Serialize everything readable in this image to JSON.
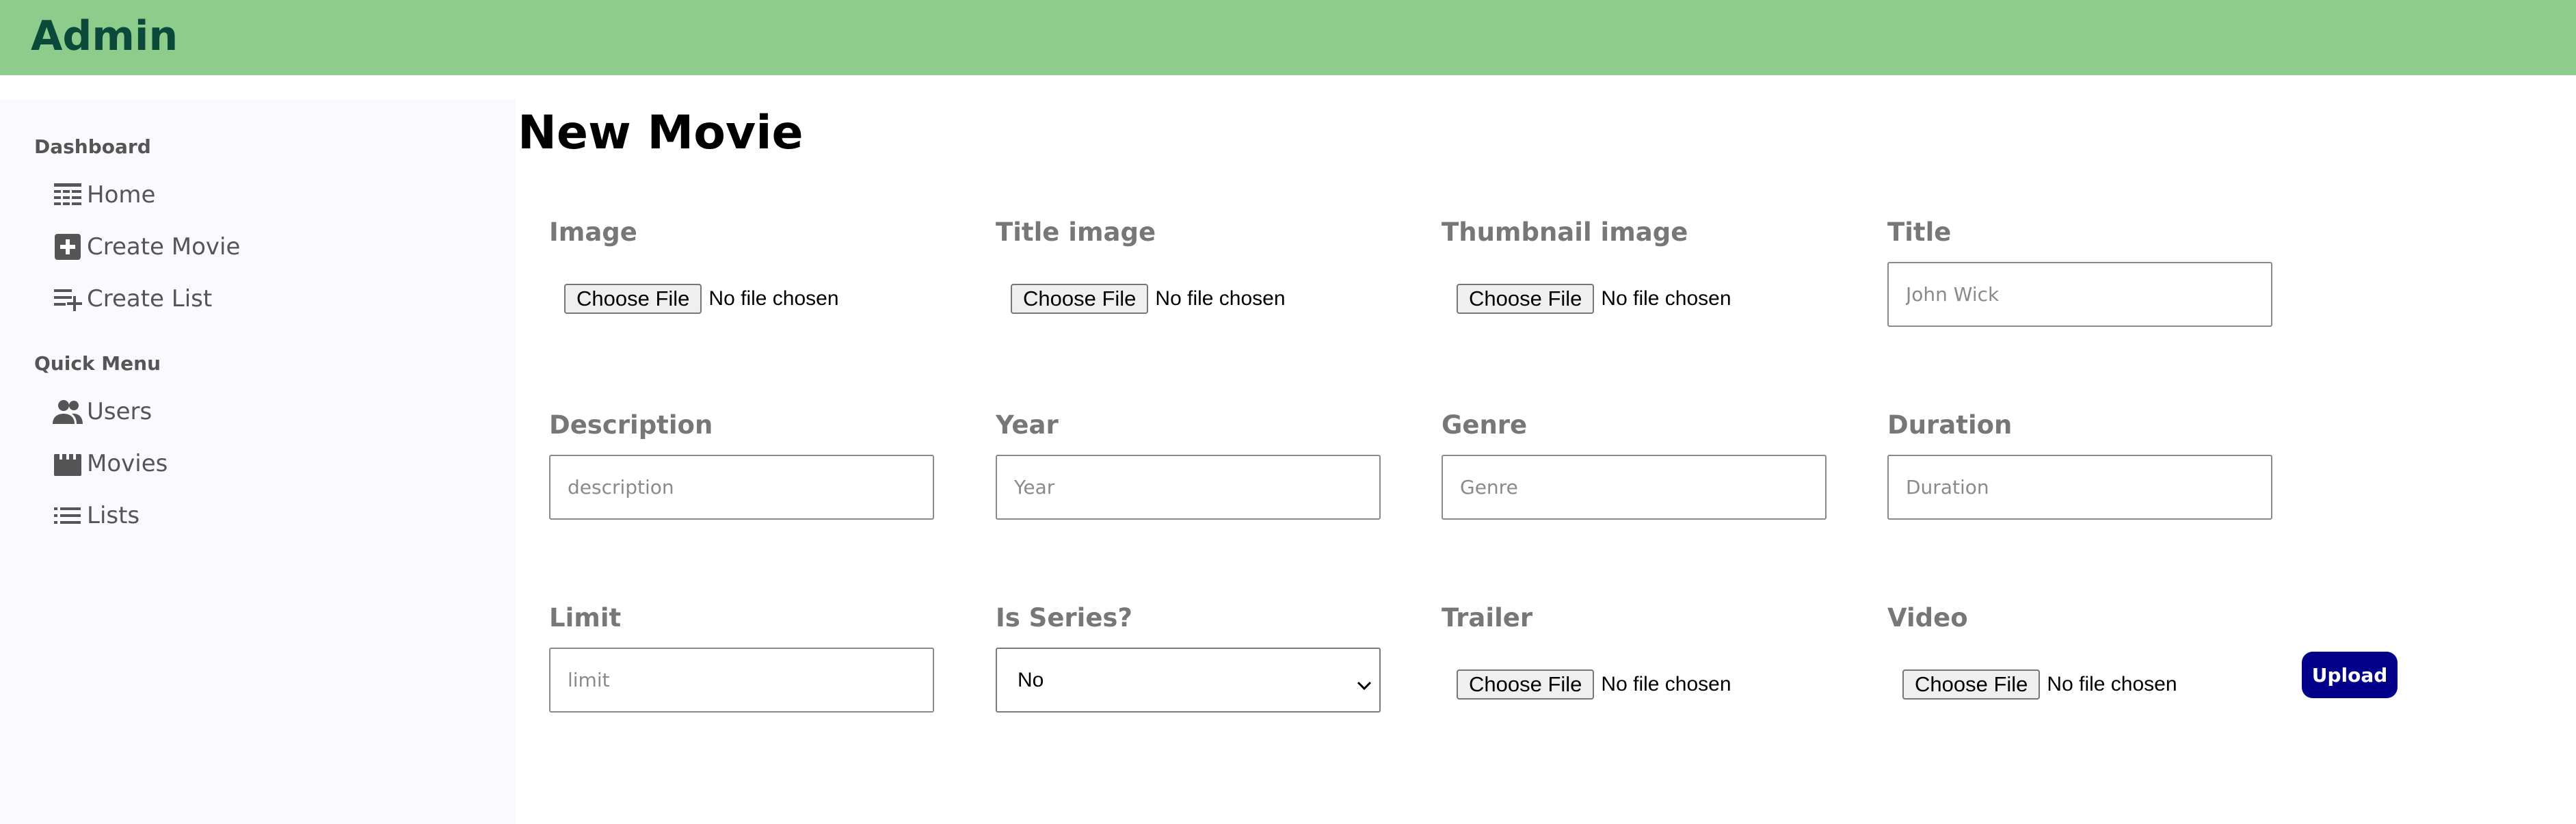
{
  "app": {
    "title": "Admin"
  },
  "sidebar": {
    "sections": [
      {
        "title": "Dashboard",
        "items": [
          {
            "label": "Home",
            "icon": "home-list-icon"
          },
          {
            "label": "Create Movie",
            "icon": "add-box-icon"
          },
          {
            "label": "Create List",
            "icon": "playlist-add-icon"
          }
        ]
      },
      {
        "title": "Quick Menu",
        "items": [
          {
            "label": "Users",
            "icon": "users-icon"
          },
          {
            "label": "Movies",
            "icon": "movie-clapper-icon"
          },
          {
            "label": "Lists",
            "icon": "list-icon"
          }
        ]
      }
    ]
  },
  "main": {
    "title": "New Movie",
    "file_button": "Choose File",
    "file_status": "No file chosen",
    "fields": {
      "image": {
        "label": "Image"
      },
      "title_image": {
        "label": "Title image"
      },
      "thumbnail_image": {
        "label": "Thumbnail image"
      },
      "title": {
        "label": "Title",
        "placeholder": "John Wick"
      },
      "description": {
        "label": "Description",
        "placeholder": "description"
      },
      "year": {
        "label": "Year",
        "placeholder": "Year"
      },
      "genre": {
        "label": "Genre",
        "placeholder": "Genre"
      },
      "duration": {
        "label": "Duration",
        "placeholder": "Duration"
      },
      "limit": {
        "label": "Limit",
        "placeholder": "limit"
      },
      "is_series": {
        "label": "Is Series?",
        "value": "No"
      },
      "trailer": {
        "label": "Trailer"
      },
      "video": {
        "label": "Video"
      }
    },
    "upload_button": "Upload"
  },
  "colors": {
    "topbar": "#8dcc8b",
    "logo": "#0b4a3b",
    "sidebar_bg": "#fafafe",
    "upload_button": "#02008a"
  }
}
